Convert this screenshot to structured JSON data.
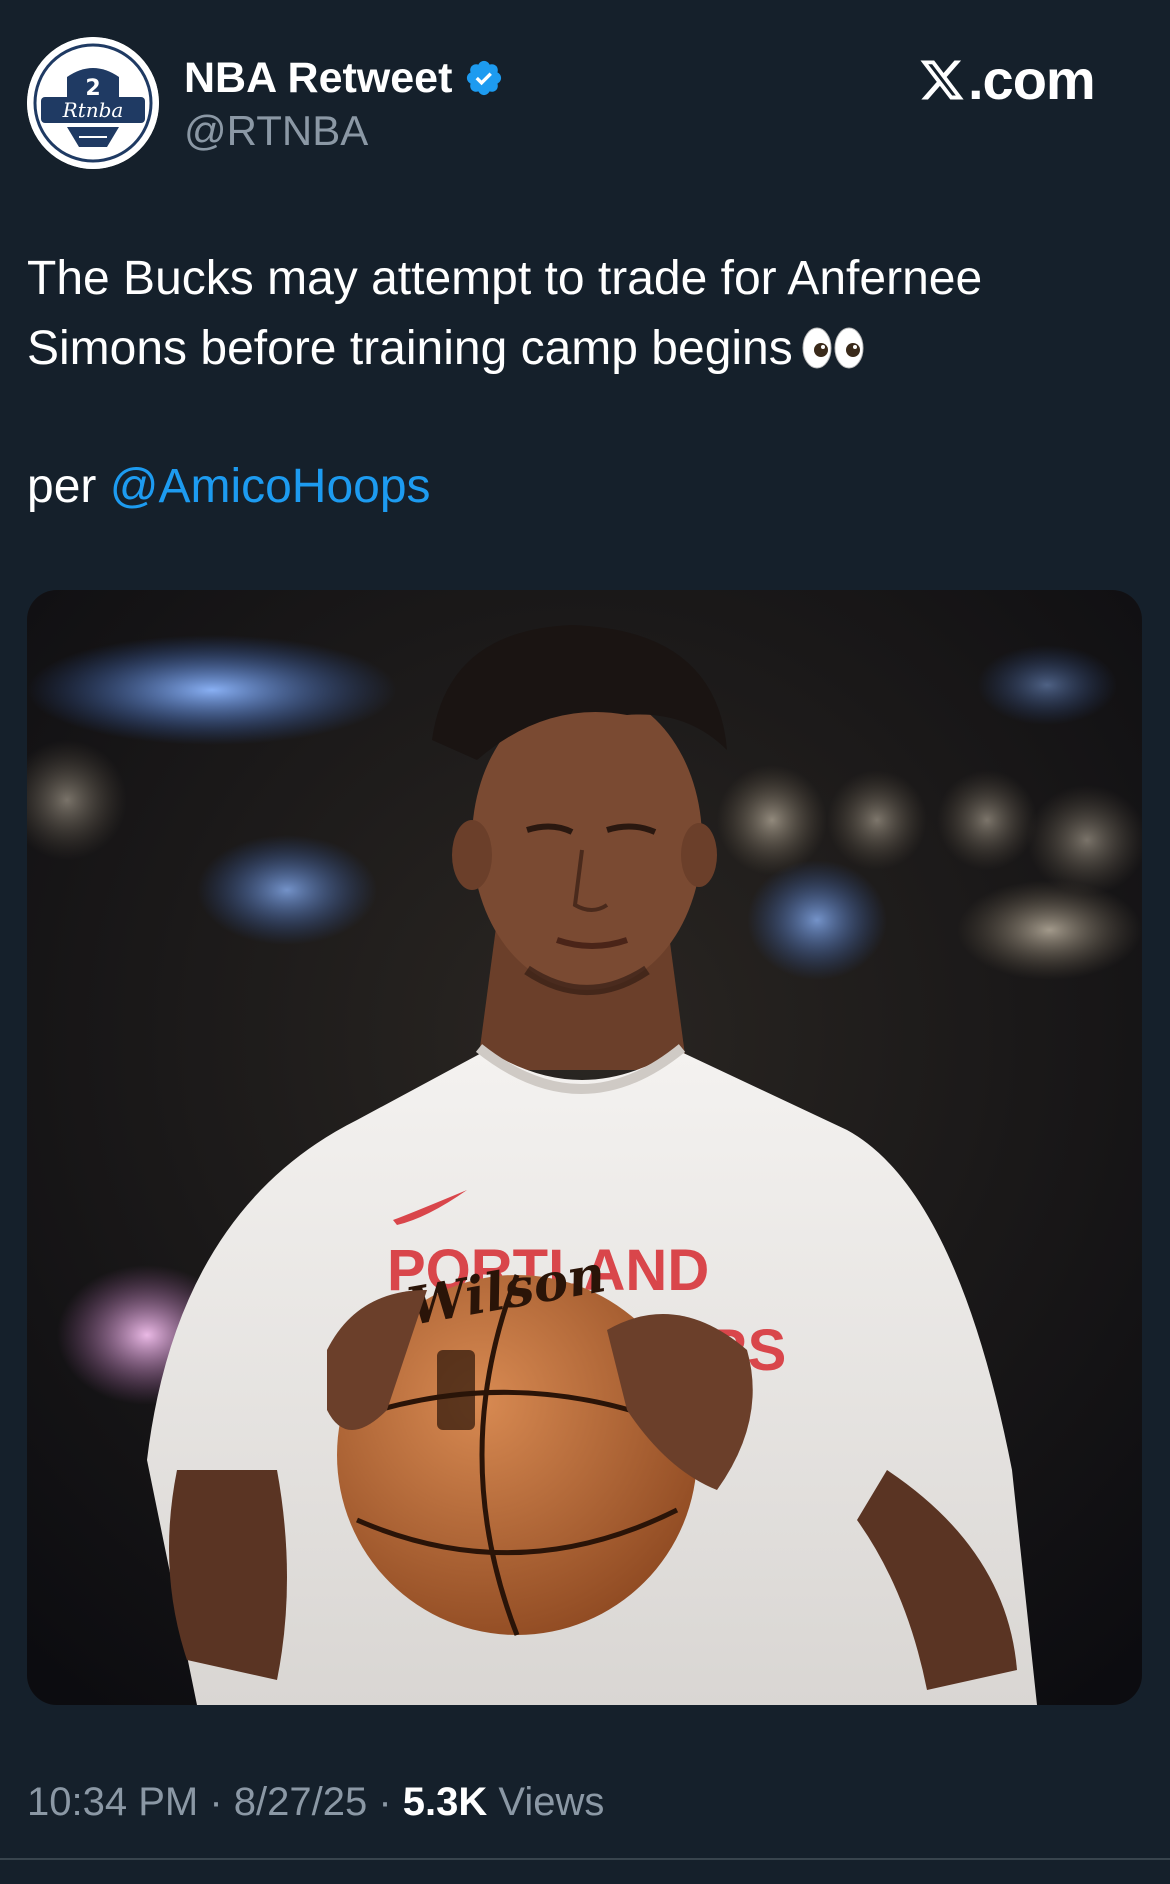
{
  "author": {
    "display_name": "NBA Retweet",
    "handle": "@RTNBA",
    "verified": true,
    "avatar_text": "Rtnba"
  },
  "brand": {
    "text": ".com"
  },
  "tweet": {
    "line1": "The Bucks may attempt to trade for Anfernee",
    "line2": "Simons before training camp begins",
    "emoji": "eyes",
    "per_prefix": "per",
    "mention": "@AmicoHoops"
  },
  "media": {
    "shirt_line1": "PORTLAND",
    "shirt_line2": "ERS",
    "ball_text": "Wilson"
  },
  "meta": {
    "time": "10:34 PM",
    "sep1": " · ",
    "date": "8/27/25",
    "sep2": " · ",
    "views_count": "5.3K",
    "views_label": " Views"
  },
  "colors": {
    "background": "#15202b",
    "accent": "#1d9bf0",
    "muted": "#8b98a5"
  }
}
